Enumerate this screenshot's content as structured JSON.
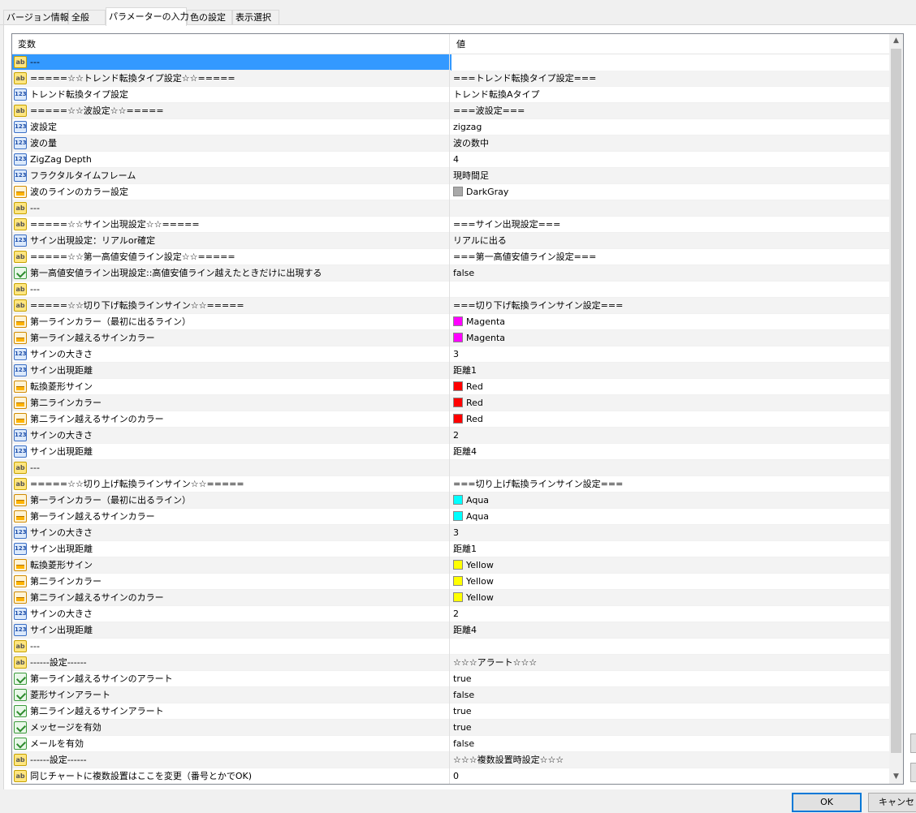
{
  "tabs": [
    "バージョン情報",
    "全般",
    "パラメーターの入力",
    "色の設定",
    "表示選択"
  ],
  "header": {
    "col_variable": "変数",
    "col_value": "値"
  },
  "rows": [
    {
      "type": "ab",
      "name": "---",
      "value": ""
    },
    {
      "type": "ab",
      "name": "=====☆☆トレンド転換タイプ設定☆☆=====",
      "value": "===トレンド転換タイプ設定==="
    },
    {
      "type": "num",
      "name": "トレンド転換タイプ設定",
      "value": "トレンド転換Aタイプ"
    },
    {
      "type": "ab",
      "name": "=====☆☆波設定☆☆=====",
      "value": "===波設定==="
    },
    {
      "type": "num",
      "name": "波設定",
      "value": "zigzag"
    },
    {
      "type": "num",
      "name": "波の量",
      "value": "波の数中"
    },
    {
      "type": "num",
      "name": "ZigZag Depth",
      "value": "4"
    },
    {
      "type": "num",
      "name": "フラクタルタイムフレーム",
      "value": "現時間足"
    },
    {
      "type": "col",
      "name": "波のラインのカラー設定",
      "value": "DarkGray",
      "swatch": "#a9a9a9"
    },
    {
      "type": "ab",
      "name": "---",
      "value": ""
    },
    {
      "type": "ab",
      "name": "=====☆☆サイン出現設定☆☆=====",
      "value": "===サイン出現設定==="
    },
    {
      "type": "num",
      "name": "サイン出現設定：リアルor確定",
      "value": "リアルに出る"
    },
    {
      "type": "ab",
      "name": "=====☆☆第一高値安値ライン設定☆☆=====",
      "value": "===第一高値安値ライン設定==="
    },
    {
      "type": "bool",
      "name": "第一高値安値ライン出現設定::高値安値ライン越えたときだけに出現する",
      "value": "false"
    },
    {
      "type": "ab",
      "name": "---",
      "value": ""
    },
    {
      "type": "ab",
      "name": "=====☆☆切り下げ転換ラインサイン☆☆=====",
      "value": "===切り下げ転換ラインサイン設定==="
    },
    {
      "type": "col",
      "name": "第一ラインカラー（最初に出るライン）",
      "value": "Magenta",
      "swatch": "#ff00ff"
    },
    {
      "type": "col",
      "name": "第一ライン越えるサインカラー",
      "value": "Magenta",
      "swatch": "#ff00ff"
    },
    {
      "type": "num",
      "name": "サインの大きさ",
      "value": "3"
    },
    {
      "type": "num",
      "name": "サイン出現距離",
      "value": "距離1"
    },
    {
      "type": "col",
      "name": "転換菱形サイン",
      "value": "Red",
      "swatch": "#ff0000"
    },
    {
      "type": "col",
      "name": "第二ラインカラー",
      "value": "Red",
      "swatch": "#ff0000"
    },
    {
      "type": "col",
      "name": "第二ライン越えるサインのカラー",
      "value": "Red",
      "swatch": "#ff0000"
    },
    {
      "type": "num",
      "name": "サインの大きさ",
      "value": "2"
    },
    {
      "type": "num",
      "name": "サイン出現距離",
      "value": "距離4"
    },
    {
      "type": "ab",
      "name": "---",
      "value": ""
    },
    {
      "type": "ab",
      "name": "=====☆☆切り上げ転換ラインサイン☆☆=====",
      "value": "===切り上げ転換ラインサイン設定==="
    },
    {
      "type": "col",
      "name": "第一ラインカラー（最初に出るライン）",
      "value": "Aqua",
      "swatch": "#00ffff"
    },
    {
      "type": "col",
      "name": "第一ライン越えるサインカラー",
      "value": "Aqua",
      "swatch": "#00ffff"
    },
    {
      "type": "num",
      "name": "サインの大きさ",
      "value": "3"
    },
    {
      "type": "num",
      "name": "サイン出現距離",
      "value": "距離1"
    },
    {
      "type": "col",
      "name": "転換菱形サイン",
      "value": "Yellow",
      "swatch": "#ffff00"
    },
    {
      "type": "col",
      "name": "第二ラインカラー",
      "value": "Yellow",
      "swatch": "#ffff00"
    },
    {
      "type": "col",
      "name": "第二ライン越えるサインのカラー",
      "value": "Yellow",
      "swatch": "#ffff00"
    },
    {
      "type": "num",
      "name": "サインの大きさ",
      "value": "2"
    },
    {
      "type": "num",
      "name": "サイン出現距離",
      "value": "距離4"
    },
    {
      "type": "ab",
      "name": "---",
      "value": ""
    },
    {
      "type": "ab",
      "name": "------設定------",
      "value": "☆☆☆アラート☆☆☆"
    },
    {
      "type": "bool",
      "name": "第一ライン越えるサインのアラート",
      "value": "true"
    },
    {
      "type": "bool",
      "name": "菱形サインアラート",
      "value": "false"
    },
    {
      "type": "bool",
      "name": "第二ライン越えるサインアラート",
      "value": "true"
    },
    {
      "type": "bool",
      "name": "メッセージを有効",
      "value": "true"
    },
    {
      "type": "bool",
      "name": "メールを有効",
      "value": "false"
    },
    {
      "type": "ab",
      "name": "------設定------",
      "value": "☆☆☆複数設置時設定☆☆☆"
    },
    {
      "type": "ab",
      "name": "同じチャートに複数設置はここを変更（番号とかでOK)",
      "value": "0"
    }
  ],
  "icons": {
    "ab": "ab",
    "num": "123"
  },
  "buttons": {
    "ok": "OK",
    "cancel": "キャンセ"
  },
  "selected_row": 0
}
